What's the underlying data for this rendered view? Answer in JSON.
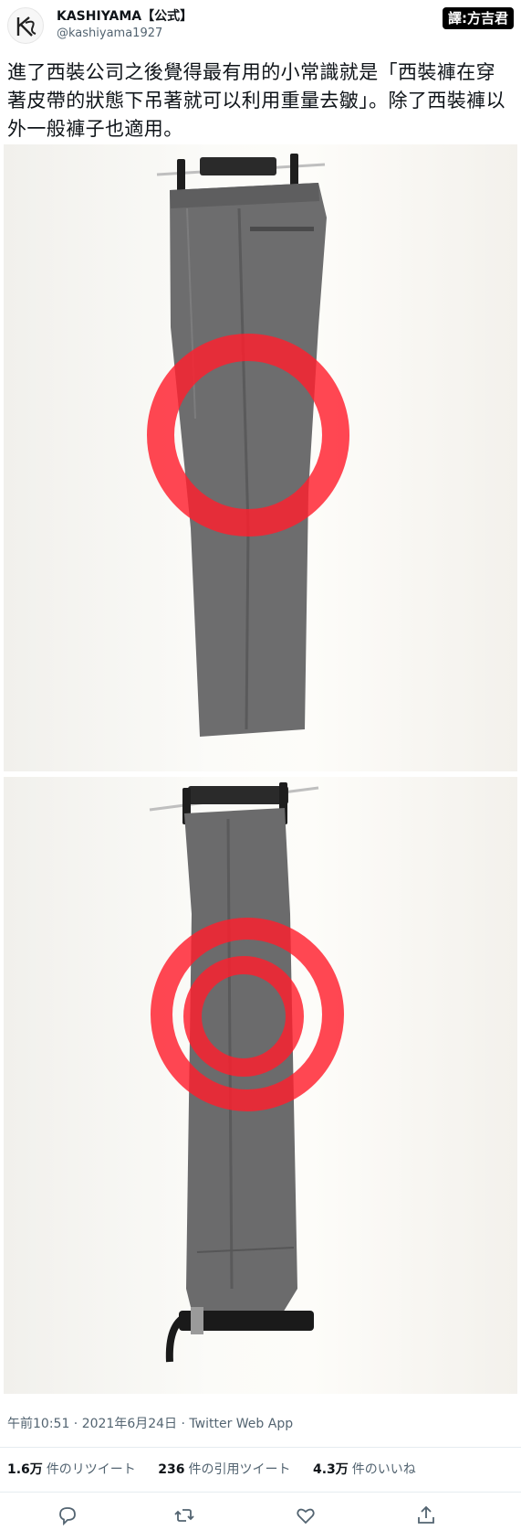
{
  "account": {
    "display_name": "KASHIYAMA【公式】",
    "handle": "@kashiyama1927",
    "avatar_icon": "kashiyama-logo-icon"
  },
  "badge": {
    "label": "譯:方吉君"
  },
  "tweet": {
    "text": "進了西裝公司之後覺得最有用的小常識就是「西裝褲在穿著皮帶的狀態下吊著就可以利用重量去皺」。除了西裝褲以外一般褲子也適用。"
  },
  "meta": {
    "timestamp": "午前10:51 · 2021年6月24日 · Twitter Web App"
  },
  "stats": {
    "retweets_count": "1.6万",
    "retweets_label": "件のリツイート",
    "quotes_count": "236",
    "quotes_label": "件の引用ツイート",
    "likes_count": "4.3万",
    "likes_label": "件のいいね"
  },
  "actions": [
    "reply-icon",
    "retweet-icon",
    "like-icon",
    "share-icon"
  ],
  "colors": {
    "highlight_circle": "#ff1f2d",
    "trouser_gray": "#6f6f70",
    "text_secondary": "#536471"
  }
}
